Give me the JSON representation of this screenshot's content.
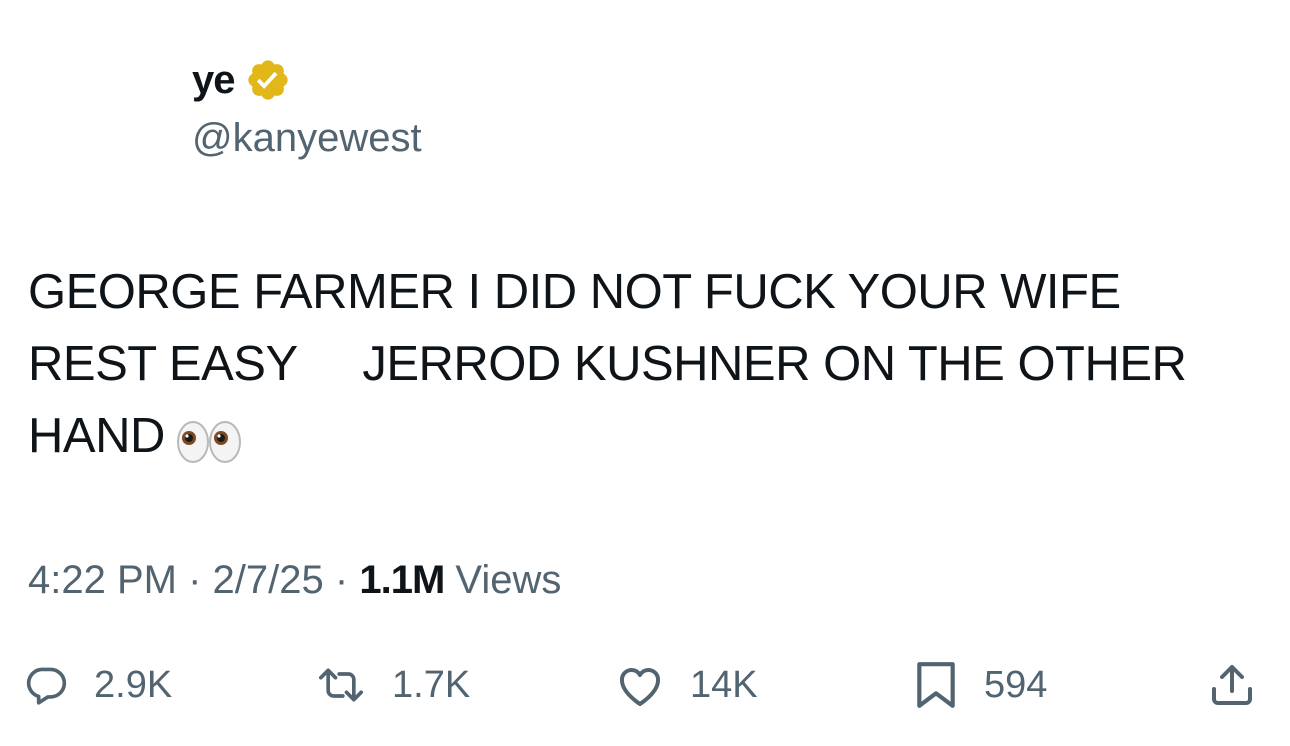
{
  "author": {
    "display_name": "ye",
    "handle": "@kanyewest",
    "verified": true,
    "verified_color": "#e2b719"
  },
  "tweet": {
    "lines": [
      "GEORGE FARMER I DID NOT FUCK YOUR WIFE",
      "REST EASY     JERROD KUSHNER ON THE OTHER",
      "HAND"
    ],
    "emoji": "eyes-icon"
  },
  "meta": {
    "time": "4:22 PM",
    "separator": "·",
    "date": "2/7/25",
    "views_count": "1.1M",
    "views_label": "Views"
  },
  "actions": {
    "replies": "2.9K",
    "reposts": "1.7K",
    "likes": "14K",
    "bookmarks": "594"
  },
  "colors": {
    "text_primary": "#0f1419",
    "text_secondary": "#536471",
    "background": "#ffffff"
  }
}
